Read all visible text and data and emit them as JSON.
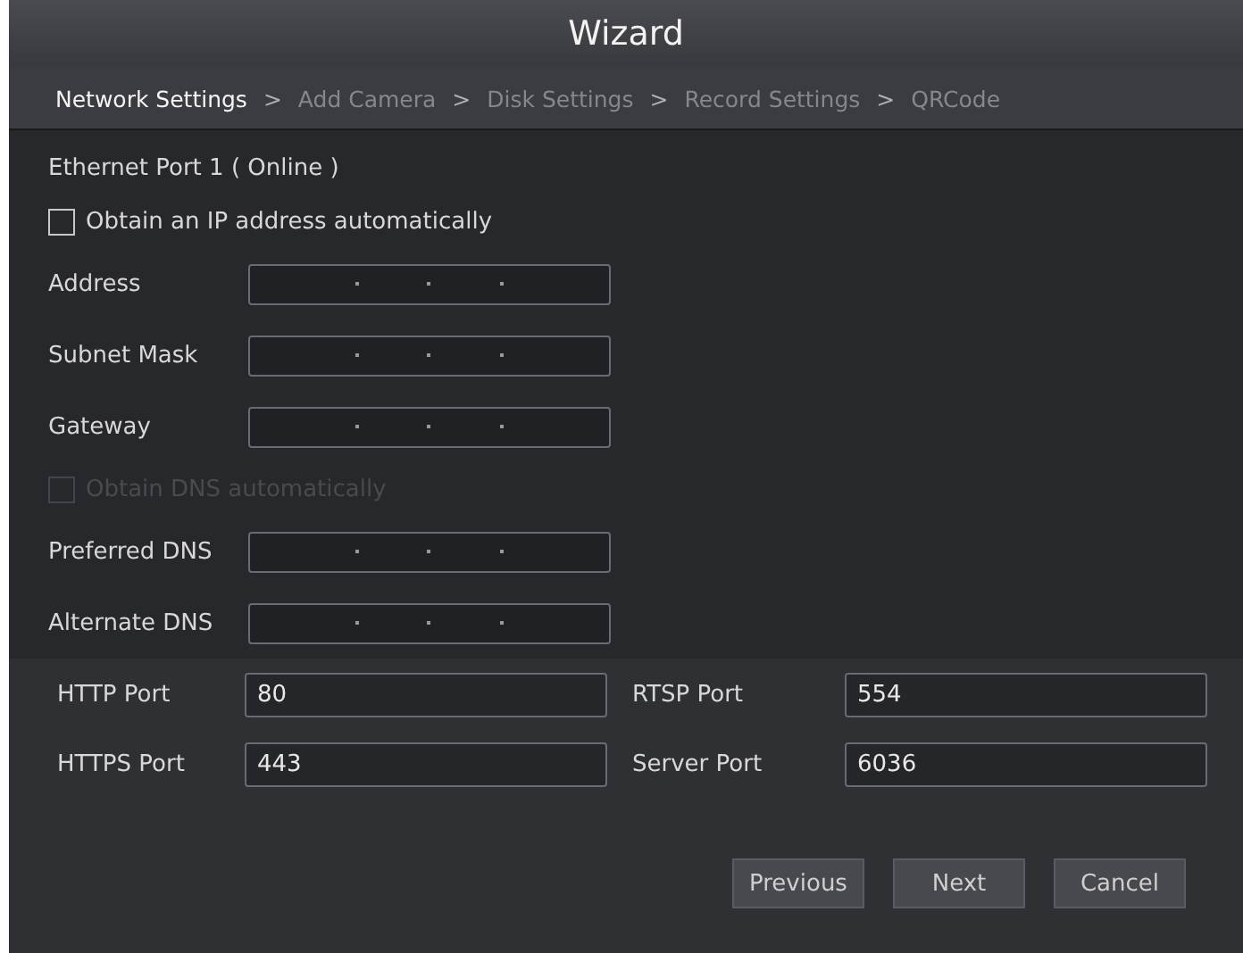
{
  "window": {
    "title": "Wizard"
  },
  "steps": [
    {
      "label": "Network Settings",
      "selected": true
    },
    {
      "label": "Add Camera",
      "selected": false
    },
    {
      "label": "Disk Settings",
      "selected": false
    },
    {
      "label": "Record Settings",
      "selected": false
    },
    {
      "label": "QRCode",
      "selected": false
    }
  ],
  "step_separator": ">",
  "section_title": "Ethernet Port 1 ( Online )",
  "obtain_ip": {
    "label": "Obtain an IP address automatically",
    "checked": false,
    "disabled": false
  },
  "ip_fields": [
    {
      "label": "Address"
    },
    {
      "label": "Subnet Mask"
    },
    {
      "label": "Gateway"
    }
  ],
  "obtain_dns": {
    "label": "Obtain DNS automatically",
    "checked": false,
    "disabled": true
  },
  "dns_fields": [
    {
      "label": "Preferred DNS"
    },
    {
      "label": "Alternate DNS"
    }
  ],
  "ports": [
    {
      "label": "HTTP Port",
      "value": "80"
    },
    {
      "label": "RTSP Port",
      "value": "554"
    },
    {
      "label": "HTTPS Port",
      "value": "443"
    },
    {
      "label": "Server Port",
      "value": "6036"
    }
  ],
  "buttons": [
    "Previous",
    "Next",
    "Cancel"
  ]
}
